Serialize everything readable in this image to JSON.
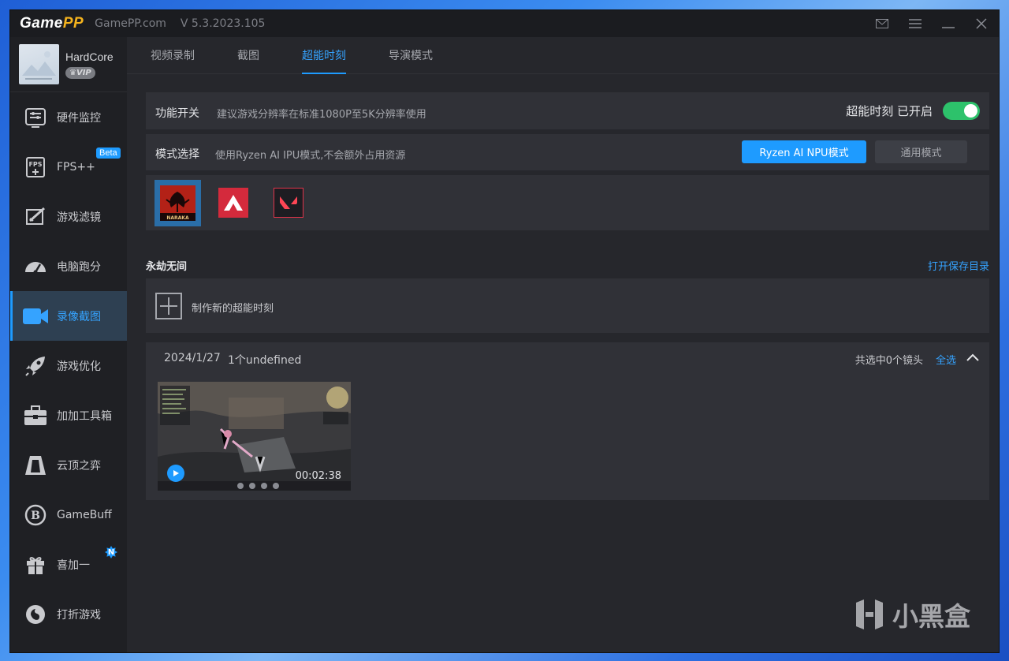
{
  "app": {
    "logo_main": "Game",
    "logo_accent": "PP",
    "site": "GamePP.com",
    "version": "V 5.3.2023.105"
  },
  "profile": {
    "username": "HardCore",
    "vip_label": "VIP"
  },
  "sidebar": {
    "items": [
      {
        "label": "硬件监控",
        "icon": "hardware-monitor-icon"
      },
      {
        "label": "FPS++",
        "icon": "fps-icon",
        "badge": "Beta"
      },
      {
        "label": "游戏滤镜",
        "icon": "game-filter-icon"
      },
      {
        "label": "电脑跑分",
        "icon": "benchmark-gauge-icon"
      },
      {
        "label": "录像截图",
        "icon": "video-camera-icon",
        "active": true
      },
      {
        "label": "游戏优化",
        "icon": "rocket-icon"
      },
      {
        "label": "加加工具箱",
        "icon": "toolbox-icon"
      },
      {
        "label": "云顶之弈",
        "icon": "tft-icon"
      },
      {
        "label": "GameBuff",
        "icon": "gamebuff-icon"
      },
      {
        "label": "喜加一",
        "icon": "gift-icon",
        "badge": "N"
      },
      {
        "label": "打折游戏",
        "icon": "discount-game-icon"
      }
    ]
  },
  "tabs": [
    {
      "label": "视频录制"
    },
    {
      "label": "截图"
    },
    {
      "label": "超能时刻",
      "active": true
    },
    {
      "label": "导演模式"
    }
  ],
  "feature_switch": {
    "label": "功能开关",
    "description": "建议游戏分辨率在标准1080P至5K分辨率使用",
    "status": "超能时刻 已开启",
    "enabled": true
  },
  "mode_select": {
    "label": "模式选择",
    "description": "使用Ryzen AI IPU模式,不会额外占用资源",
    "primary_button": "Ryzen AI NPU模式",
    "secondary_button": "通用模式"
  },
  "games": [
    {
      "name": "NARAKA",
      "icon": "naraka-icon",
      "selected": true
    },
    {
      "name": "apex",
      "icon": "apex-legends-icon"
    },
    {
      "name": "valorant",
      "icon": "valorant-icon"
    }
  ],
  "section": {
    "title": "永劫无间",
    "open_folder": "打开保存目录"
  },
  "create": {
    "label": "制作新的超能时刻"
  },
  "clips": {
    "date": "2024/1/27",
    "count_text": "1个undefined",
    "selected_text": "共选中0个镜头",
    "select_all": "全选",
    "items": [
      {
        "duration": "00:02:38"
      }
    ]
  },
  "watermark": {
    "text": "小黑盒"
  },
  "colors": {
    "accent": "#1e9bff",
    "toggle_on": "#2dc26b",
    "logo_accent": "#f4b31e"
  }
}
